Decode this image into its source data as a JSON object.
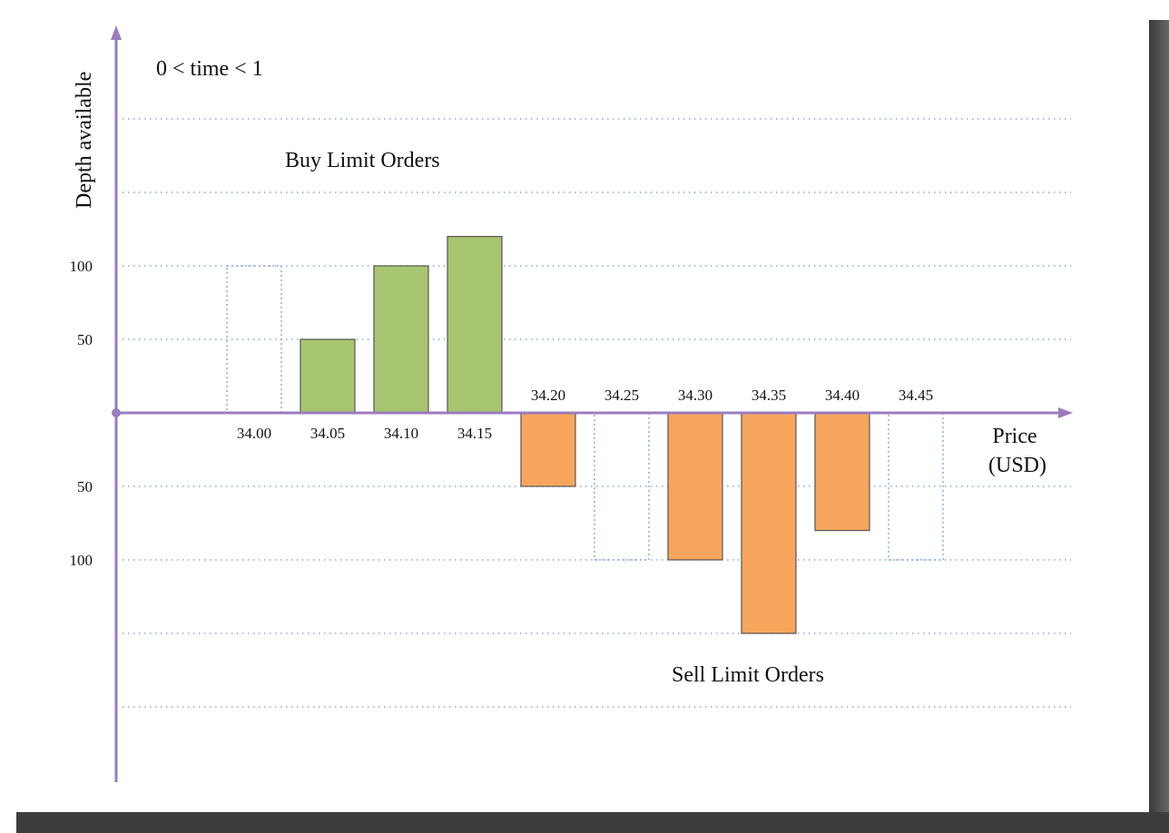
{
  "chart_data": {
    "type": "bar",
    "title": "0 < time < 1",
    "ylabel": "Depth available",
    "xlabel": "Price\n(USD)",
    "ylim": [
      -250,
      250
    ],
    "grid": true,
    "y_tick_labels": [
      {
        "label": "100",
        "value": 100
      },
      {
        "label": "50",
        "value": 50
      },
      {
        "label": "50",
        "value": -50
      },
      {
        "label": "100",
        "value": -100
      }
    ],
    "gridline_values": [
      200,
      150,
      100,
      50,
      -50,
      -100,
      -150,
      -200
    ],
    "categories": [
      "34.00",
      "34.05",
      "34.10",
      "34.15",
      "34.20",
      "34.25",
      "34.30",
      "34.35",
      "34.40",
      "34.45"
    ],
    "series": [
      {
        "name": "Buy Limit Orders",
        "color": "#a8c56f",
        "values": [
          0,
          50,
          100,
          120,
          null,
          null,
          null,
          null,
          null,
          null
        ]
      },
      {
        "name": "Sell Limit Orders",
        "color": "#f8a55e",
        "values": [
          null,
          null,
          null,
          null,
          -50,
          0,
          -100,
          -150,
          -80,
          0
        ]
      }
    ],
    "outline_bars": [
      {
        "category": "34.00",
        "value": 100
      },
      {
        "category": "34.25",
        "value": -100
      },
      {
        "category": "34.45",
        "value": -100
      }
    ],
    "annotations": [
      "Buy Limit Orders",
      "Sell Limit Orders"
    ],
    "colors": {
      "axis": "#9b7cbf",
      "grid": "#8ea6d8",
      "bar_stroke": "#555555",
      "outline_bar": "#8eaee0"
    }
  }
}
